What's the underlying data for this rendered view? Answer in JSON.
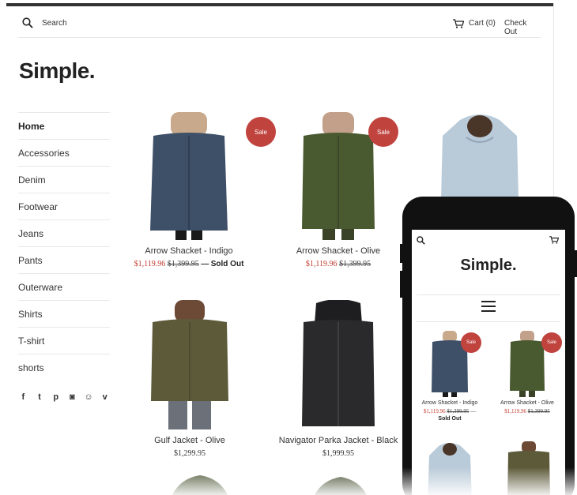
{
  "header": {
    "search_label": "Search",
    "cart_label": "Cart (0)",
    "checkout_label": "Check Out",
    "search_icon": "search-icon",
    "cart_icon": "cart-icon"
  },
  "logo": "Simple.",
  "sidebar": {
    "items": [
      {
        "label": "Home",
        "active": true
      },
      {
        "label": "Accessories"
      },
      {
        "label": "Denim"
      },
      {
        "label": "Footwear"
      },
      {
        "label": "Jeans"
      },
      {
        "label": "Pants"
      },
      {
        "label": "Outerware"
      },
      {
        "label": "Shirts"
      },
      {
        "label": "T-shirt"
      },
      {
        "label": "shorts"
      }
    ],
    "social": [
      "facebook-icon",
      "twitter-icon",
      "pinterest-icon",
      "instagram-icon",
      "snapchat-icon",
      "vimeo-icon"
    ]
  },
  "products": [
    {
      "title": "Arrow Shacket - Indigo",
      "sale_price": "$1,119.96",
      "original_price": "$1,399.95",
      "separator": "—",
      "status": "Sold Out",
      "badge": "Sale",
      "color": "#3e5068"
    },
    {
      "title": "Arrow Shacket - Olive",
      "sale_price": "$1,119.96",
      "original_price": "$1,399.95",
      "badge": "Sale",
      "color": "#4a5a30"
    },
    {
      "title": "Gulf Jacket - Olive",
      "price": "$1,299.95",
      "color": "#5d5a3a"
    },
    {
      "title": "Navigator Parka Jacket - Black",
      "price": "$1,999.95",
      "color": "#2a2a2c"
    }
  ],
  "mobile": {
    "logo": "Simple.",
    "products": [
      {
        "title": "Arrow Shacket - Indigo",
        "sale_price": "$1,119.96",
        "original_price": "$1,399.95",
        "separator": "—",
        "status": "Sold Out",
        "badge": "Sale"
      },
      {
        "title": "Arrow Shacket - Olive",
        "sale_price": "$1,119.96",
        "original_price": "$1,399.95",
        "badge": "Sale"
      }
    ]
  },
  "colors": {
    "sale_badge": "#c0433e",
    "sale_price": "#c0392b",
    "topbar": "#333333"
  }
}
